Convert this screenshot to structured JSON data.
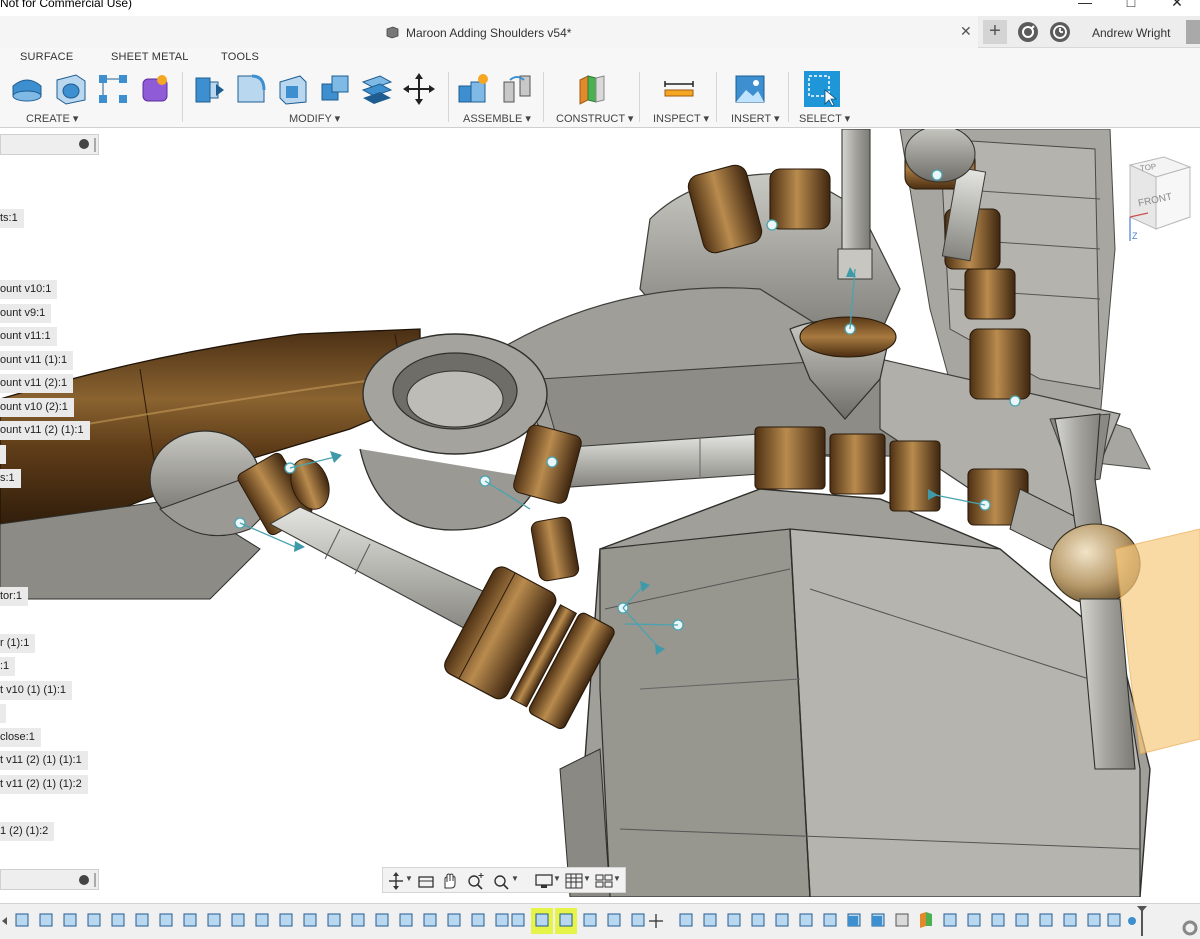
{
  "window": {
    "title_fragment": "Not for Commercial Use)",
    "minimize_label": "—",
    "maximize_label": "□",
    "close_label": "✕"
  },
  "document_tab": {
    "name": "Maroon Adding Shoulders v54*",
    "close_label": "✕",
    "new_tab_label": "+"
  },
  "user": {
    "name": "Andrew Wright"
  },
  "workspace_tabs": [
    "SURFACE",
    "SHEET METAL",
    "TOOLS"
  ],
  "groups": {
    "create": "CREATE ▾",
    "modify": "MODIFY ▾",
    "assemble": "ASSEMBLE ▾",
    "construct": "CONSTRUCT ▾",
    "inspect": "INSPECT ▾",
    "insert": "INSERT ▾",
    "select": "SELECT ▾"
  },
  "browser": {
    "nodes": [
      "ts:1",
      "ount v10:1",
      "ount v9:1",
      "ount v11:1",
      "ount v11 (1):1",
      "ount v11 (2):1",
      "ount v10 (2):1",
      "ount v11 (2) (1):1",
      "s:1",
      "tor:1",
      "r (1):1",
      ":1",
      "t v10 (1) (1):1",
      "close:1",
      "t v11 (2) (1) (1):1",
      "t v11 (2) (1) (1):2",
      "1 (2) (1):2"
    ]
  },
  "viewcube": {
    "top": "TOP",
    "front": "FRONT",
    "axis_z": "Z"
  },
  "colors": {
    "accent_blue": "#1e96d8",
    "selection_highlight": "#e6f44a",
    "bronze": "#7a5226",
    "steel": "#8e8e88"
  }
}
